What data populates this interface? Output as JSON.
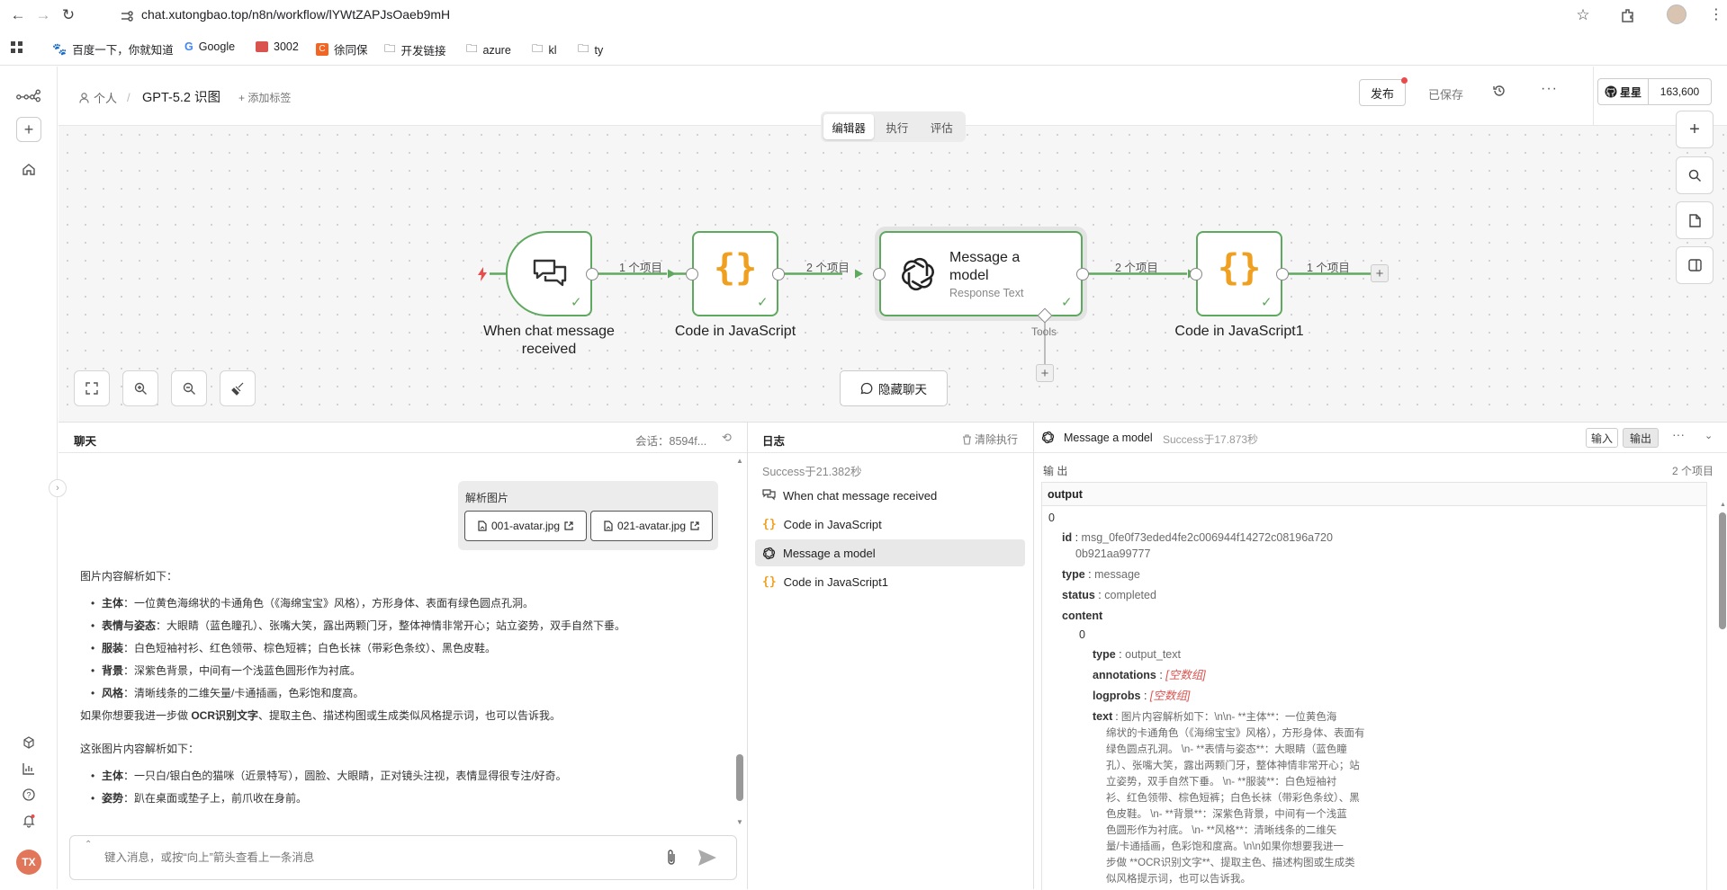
{
  "browser": {
    "url": "chat.xutongbao.top/n8n/workflow/lYWtZAPJsOaeb9mH",
    "bookmarks": [
      "百度一下，你就知道",
      "Google",
      "3002",
      "徐同保",
      "开发链接",
      "azure",
      "kl",
      "ty"
    ]
  },
  "header": {
    "owner": "个人",
    "workflow_name": "GPT-5.2 识图",
    "add_tag": "+ 添加标签",
    "publish": "发布",
    "saved": "已保存",
    "star_label": "星星",
    "star_count": "163,600"
  },
  "tabs": [
    "编辑器",
    "执行",
    "评估"
  ],
  "canvas": {
    "nodes": [
      {
        "name": "When chat message received",
        "line1": "When chat message",
        "line2": "received"
      },
      {
        "name": "Code in JavaScript"
      },
      {
        "name": "Message a model",
        "line1": "Message a",
        "line2": "model",
        "subtitle": "Response Text"
      },
      {
        "name": "Code in JavaScript1"
      }
    ],
    "connections": [
      "1 个项目",
      "2 个项目",
      "2 个项目",
      "1 个项目"
    ],
    "tools_label": "Tools",
    "hide_chat": "隐藏聊天"
  },
  "chat": {
    "title": "聊天",
    "session_label": "会话：8594f...",
    "user_message": {
      "text": "解析图片",
      "files": [
        "001-avatar.jpg",
        "021-avatar.jpg"
      ]
    },
    "reply1_intro": "图片内容解析如下：",
    "reply1_items": [
      {
        "k": "主体",
        "v": "：一位黄色海绵状的卡通角色（《海绵宝宝》风格），方形身体、表面有绿色圆点孔洞。"
      },
      {
        "k": "表情与姿态",
        "v": "：大眼睛（蓝色瞳孔）、张嘴大笑，露出两颗门牙，整体神情非常开心；站立姿势，双手自然下垂。"
      },
      {
        "k": "服装",
        "v": "：白色短袖衬衫、红色领带、棕色短裤；白色长袜（带彩色条纹）、黑色皮鞋。"
      },
      {
        "k": "背景",
        "v": "：深紫色背景，中间有一个浅蓝色圆形作为衬底。"
      },
      {
        "k": "风格",
        "v": "：清晰线条的二维矢量/卡通插画，色彩饱和度高。"
      }
    ],
    "reply1_outro_pre": "如果你想要我进一步做 ",
    "reply1_outro_bold": "OCR识别文字",
    "reply1_outro_post": "、提取主色、描述构图或生成类似风格提示词，也可以告诉我。",
    "reply2_intro": "这张图片内容解析如下：",
    "reply2_items": [
      {
        "k": "主体",
        "v": "：一只白/银白色的猫咪（近景特写），圆脸、大眼睛，正对镜头注视，表情显得很专注/好奇。"
      },
      {
        "k": "姿势",
        "v": "：趴在桌面或垫子上，前爪收在身前。"
      }
    ],
    "input_placeholder": "键入消息，或按“向上”箭头查看上一条消息"
  },
  "logs": {
    "title": "日志",
    "clear": "清除执行",
    "status": "Success于21.382秒",
    "items": [
      "When chat message received",
      "Code in JavaScript",
      "Message a model",
      "Code in JavaScript1"
    ]
  },
  "output": {
    "node": "Message a model",
    "status": "Success于17.873秒",
    "input_btn": "输入",
    "output_btn": "输出",
    "section": "输 出",
    "count": "2 个项目",
    "tab": "output",
    "json": {
      "index0": "0",
      "id_key": "id",
      "id_val_1": "msg_0fe0f73eded4fe2c006944f14272c08196a720",
      "id_val_2": "0b921aa99777",
      "type_key": "type",
      "type_val": "message",
      "status_key": "status",
      "status_val": "completed",
      "content_key": "content",
      "content_index": "0",
      "ctype_key": "type",
      "ctype_val": "output_text",
      "ann_key": "annotations",
      "ann_val": "[空数组]",
      "logprobs_key": "logprobs",
      "logprobs_val": "[空数组]",
      "text_key": "text",
      "text_lines": [
        "图片内容解析如下：\\n\\n- **主体**：一位黄色海",
        "绵状的卡通角色（《海绵宝宝》风格），方形身体、表面有",
        "绿色圆点孔洞。 \\n- **表情与姿态**：大眼睛（蓝色瞳",
        "孔）、张嘴大笑，露出两颗门牙，整体神情非常开心；站",
        "立姿势，双手自然下垂。 \\n- **服装**：白色短袖衬",
        "衫、红色领带、棕色短裤；白色长袜（带彩色条纹）、黑",
        "色皮鞋。 \\n- **背景**：深紫色背景，中间有一个浅蓝",
        "色圆形作为衬底。 \\n- **风格**：清晰线条的二维矢",
        "量/卡通插画，色彩饱和度高。\\n\\n如果你想要我进一",
        "步做 **OCR识别文字**、提取主色、描述构图或生成类",
        "似风格提示词，也可以告诉我。"
      ]
    }
  },
  "user_initials": "TX",
  "colors": {
    "success": "#5fa85f",
    "code_orange": "#f0a020",
    "accent_red": "#ea4b4b"
  }
}
